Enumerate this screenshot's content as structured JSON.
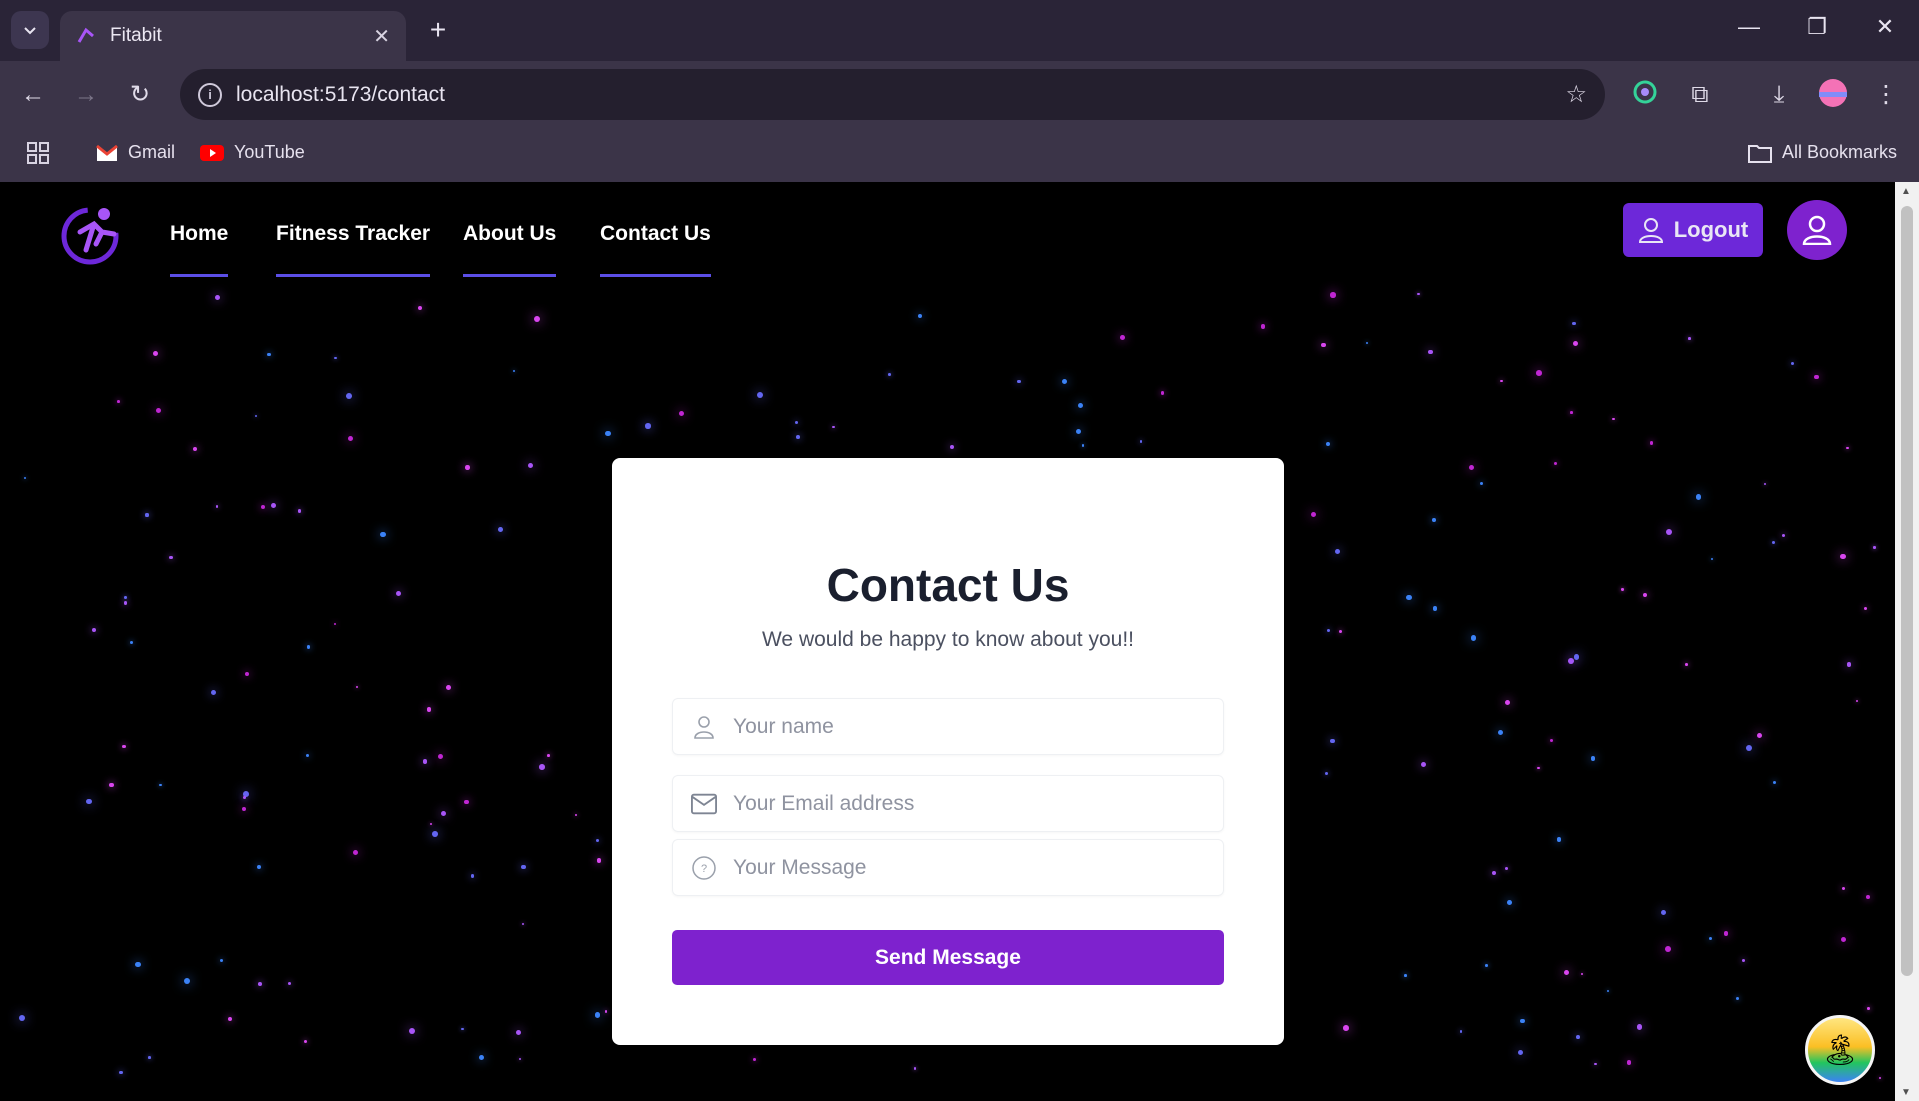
{
  "browser": {
    "tab_title": "Fitabit",
    "url": "localhost:5173/contact",
    "bookmarks": [
      {
        "label": "Gmail"
      },
      {
        "label": "YouTube"
      }
    ],
    "all_bookmarks": "All Bookmarks"
  },
  "nav": {
    "links": [
      {
        "label": "Home"
      },
      {
        "label": "Fitness Tracker"
      },
      {
        "label": "About Us"
      },
      {
        "label": "Contact Us"
      }
    ],
    "logout_label": "Logout"
  },
  "contact": {
    "title": "Contact Us",
    "subtitle": "We would be happy to know about you!!",
    "name_placeholder": "Your name",
    "email_placeholder": "Your Email address",
    "message_placeholder": "Your Message",
    "send_label": "Send Message"
  },
  "colors": {
    "accent": "#7e22ce",
    "nav_underline": "#5b4ee6"
  }
}
